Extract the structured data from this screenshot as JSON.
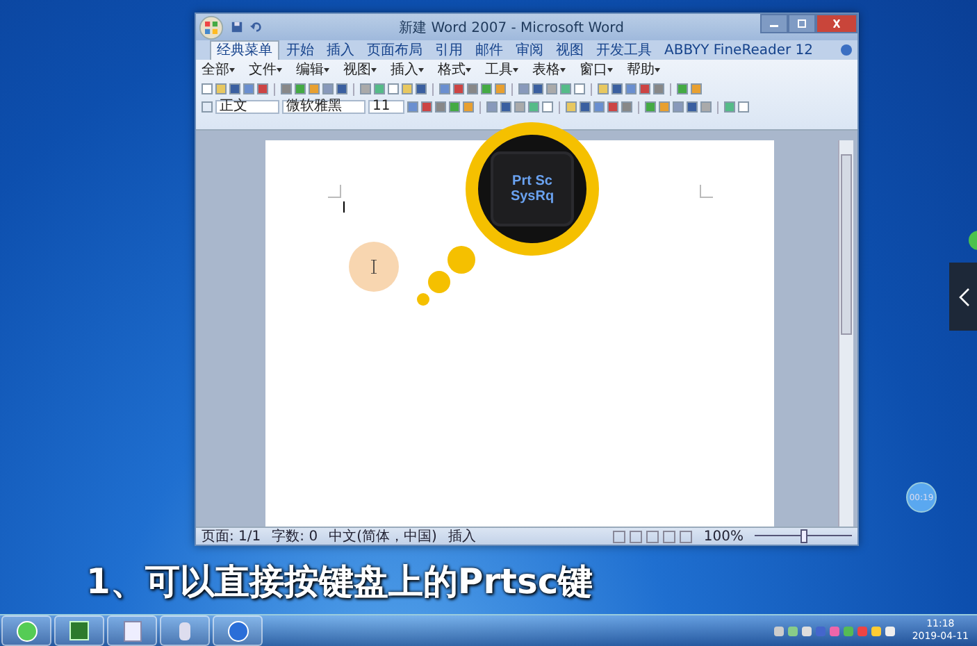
{
  "window": {
    "title": "新建 Word 2007 - Microsoft Word"
  },
  "ribbon_tabs": [
    {
      "label": "经典菜单",
      "selected": true
    },
    {
      "label": "开始",
      "selected": false
    },
    {
      "label": "插入",
      "selected": false
    },
    {
      "label": "页面布局",
      "selected": false
    },
    {
      "label": "引用",
      "selected": false
    },
    {
      "label": "邮件",
      "selected": false
    },
    {
      "label": "审阅",
      "selected": false
    },
    {
      "label": "视图",
      "selected": false
    },
    {
      "label": "开发工具",
      "selected": false
    },
    {
      "label": "ABBYY FineReader 12",
      "selected": false
    }
  ],
  "menu_bar": [
    "全部",
    "文件",
    "编辑",
    "视图",
    "插入",
    "格式",
    "工具",
    "表格",
    "窗口",
    "帮助"
  ],
  "format_toolbar": {
    "style": "正文",
    "font": "微软雅黑",
    "size": "11"
  },
  "status_bar": {
    "items": [
      "页面: 1/1",
      "字数: 0",
      "中文(简体，中国)",
      "插入"
    ],
    "zoom": "100%",
    "level": 0.5
  },
  "magnifier": {
    "key_lines": [
      "Prt Sc",
      "SysRq"
    ]
  },
  "caption": "1、可以直接按键盘上的Prtsc键",
  "timer": "00:19",
  "taskbar": {
    "time": "11:18",
    "date": "2019-04-11"
  }
}
